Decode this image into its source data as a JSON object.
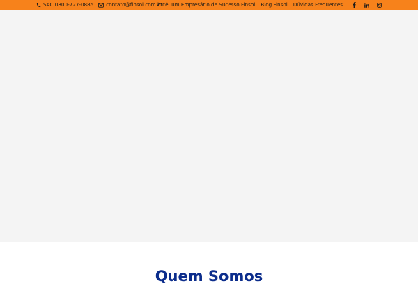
{
  "topbar": {
    "phone_icon": "phone-icon",
    "phone": "SAC 0800-727-0885",
    "email_icon": "mail-icon",
    "email": "contato@finsol.com.br",
    "links": [
      "Você, um Empresário de Sucesso Finsol",
      "Blog Finsol",
      "Dúvidas Frequentes"
    ],
    "socials": [
      "facebook-icon",
      "linkedin-icon",
      "instagram-icon"
    ],
    "colors": {
      "background": "#f7821b",
      "text": "#1a1a1a"
    }
  },
  "hero": {
    "background": "#f4f4f4"
  },
  "section": {
    "title": "Quem Somos",
    "title_color": "#0c2d8c"
  }
}
